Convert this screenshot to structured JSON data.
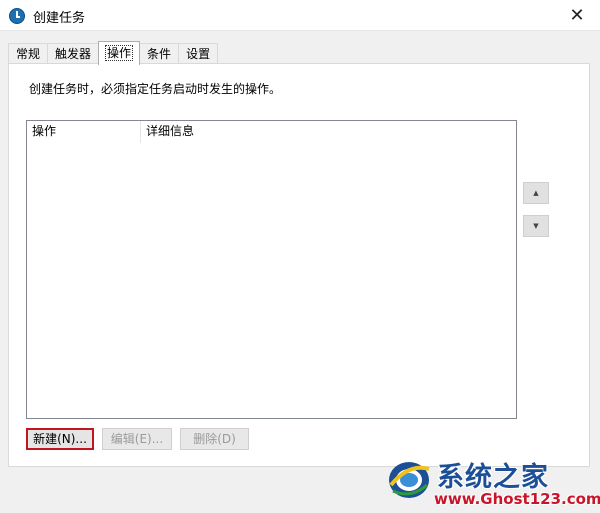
{
  "window": {
    "title": "创建任务"
  },
  "tabs": [
    {
      "label": "常规"
    },
    {
      "label": "触发器"
    },
    {
      "label": "操作"
    },
    {
      "label": "条件"
    },
    {
      "label": "设置"
    }
  ],
  "actions_panel": {
    "description": "创建任务时，必须指定任务启动时发生的操作。",
    "columns": [
      "操作",
      "详细信息"
    ],
    "move_up_glyph": "▲",
    "move_down_glyph": "▼",
    "buttons": {
      "new": "新建(N)...",
      "edit": "编辑(E)...",
      "delete": "删除(D)"
    }
  },
  "watermark": {
    "title": "系统之家",
    "url": "www.Ghost123.com"
  },
  "icons": {
    "title": "task-scheduler-clock-icon",
    "close": "close-icon",
    "up": "arrow-up-icon",
    "down": "arrow-down-icon"
  },
  "colors": {
    "highlight_border": "#c0161f",
    "watermark_blue": "#1d4f96",
    "watermark_red": "#c9152b"
  }
}
